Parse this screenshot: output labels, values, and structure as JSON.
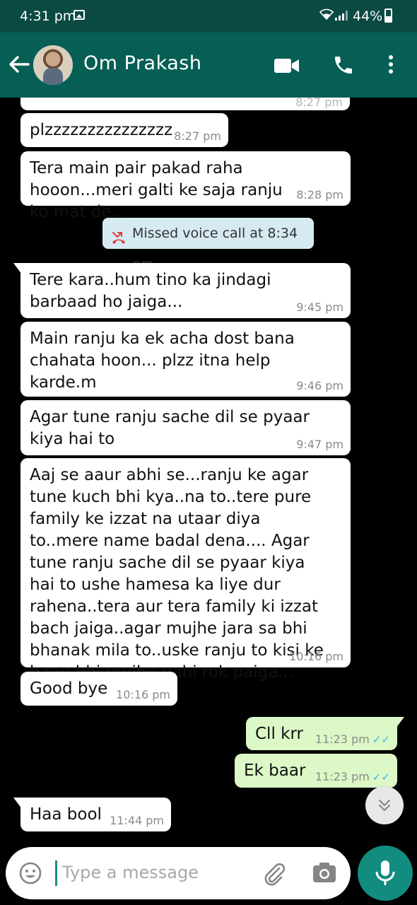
{
  "status_bar": {
    "time": "4:31 pm",
    "battery": "44%",
    "icons": [
      "gallery-icon",
      "wifi-icon",
      "signal-icon",
      "battery-icon"
    ]
  },
  "header": {
    "contact_name": "Om Prakash",
    "icons": [
      "back-arrow-icon",
      "avatar",
      "video-call-icon",
      "phone-icon",
      "more-vert-icon"
    ]
  },
  "messages": [
    {
      "id": "m0",
      "direction": "in",
      "text": "",
      "time": "8:27 pm"
    },
    {
      "id": "m1",
      "direction": "in",
      "text": "plzzzzzzzzzzzzzzz",
      "time": "8:27 pm"
    },
    {
      "id": "m2",
      "direction": "in",
      "text": "Tera main pair pakad raha hooon...meri galti ke saja ranju ko mat de...",
      "time": "8:28 pm"
    },
    {
      "id": "sys",
      "direction": "system",
      "text": "Missed voice call at 8:34 pm"
    },
    {
      "id": "m3",
      "direction": "in",
      "text": "Tere kara..hum tino ka jindagi barbaad ho jaiga...",
      "time": "9:45 pm"
    },
    {
      "id": "m4",
      "direction": "in",
      "text": "Main ranju ka ek acha dost bana chahata hoon... plzz itna help karde.m",
      "time": "9:46 pm"
    },
    {
      "id": "m5",
      "direction": "in",
      "text": "Agar tune ranju sache dil se pyaar kiya hai to",
      "time": "9:47 pm"
    },
    {
      "id": "m6",
      "direction": "in",
      "text": "Aaj se aaur abhi se...ranju ke agar tune kuch bhi kya..na to..tere pure family ke izzat na utaar diya to..mere name badal dena.... Agar tune ranju sache dil se pyaar kiya hai to ushe hamesa ka liye dur rahena..tera aur tera family ki izzat bach jaiga..agar mujhe jara sa bhi bhanak mila to..uske ranju to kisi ke baap bhi mujhe nahi rok paiga...",
      "time": "10:16 pm"
    },
    {
      "id": "m7",
      "direction": "in",
      "text": "Good bye",
      "time": "10:16 pm"
    },
    {
      "id": "m8",
      "direction": "out",
      "text": "Cll krr",
      "time": "11:23 pm",
      "ticks": "✓✓"
    },
    {
      "id": "m9",
      "direction": "out",
      "text": "Ek baar",
      "time": "11:23 pm",
      "ticks": "✓✓"
    },
    {
      "id": "m10",
      "direction": "in",
      "text": "Haa bool",
      "time": "11:44 pm"
    }
  ],
  "input": {
    "placeholder": "Type a message",
    "value": ""
  },
  "colors": {
    "status_bar": "#0b4a43",
    "app_bar": "#075e54",
    "incoming_bubble": "#ffffff",
    "outgoing_bubble": "#dcf8c6",
    "read_ticks": "#34b7f1",
    "mic_button": "#128c7e",
    "missed_call": "#e53935",
    "system_bubble": "#d6eaf2"
  }
}
